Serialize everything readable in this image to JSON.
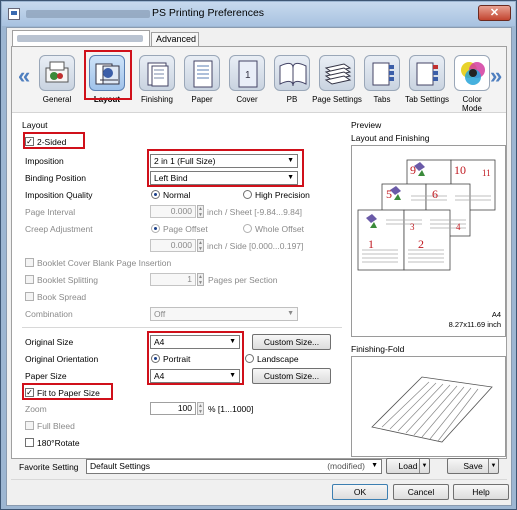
{
  "window": {
    "title": "PS Printing Preferences",
    "close_glyph": "✕"
  },
  "tabs": {
    "advanced": "Advanced"
  },
  "toolbar": {
    "items": [
      {
        "label": "General"
      },
      {
        "label": "Layout"
      },
      {
        "label": "Finishing"
      },
      {
        "label": "Paper"
      },
      {
        "label": "Cover"
      },
      {
        "label": "PB"
      },
      {
        "label": "Page Settings"
      },
      {
        "label": "Tabs"
      },
      {
        "label": "Tab Settings"
      },
      {
        "label": "Color\nMode"
      }
    ],
    "selected": "Layout"
  },
  "layout": {
    "group_title": "Layout",
    "two_sided": {
      "label": "2-Sided",
      "checked": true
    },
    "imposition": {
      "label": "Imposition",
      "value": "2 in 1 (Full Size)"
    },
    "binding_position": {
      "label": "Binding Position",
      "value": "Left Bind"
    },
    "imposition_quality": {
      "label": "Imposition Quality",
      "options": [
        "Normal",
        "High Precision"
      ],
      "selected": "Normal"
    },
    "page_interval": {
      "label": "Page Interval",
      "value": "0.000",
      "unit": "inch / Sheet [-9.84...9.84]"
    },
    "creep_adjustment": {
      "label": "Creep Adjustment",
      "options": [
        "Page Offset",
        "Whole Offset"
      ],
      "value": "0.000",
      "unit": "inch / Side [0.000...0.197]"
    },
    "booklet_cover_blank": {
      "label": "Booklet Cover Blank Page Insertion"
    },
    "booklet_splitting": {
      "label": "Booklet Splitting",
      "value": "1",
      "unit": "Pages per Section"
    },
    "book_spread": {
      "label": "Book Spread"
    },
    "combination": {
      "label": "Combination",
      "value": "Off"
    },
    "original_size": {
      "label": "Original Size",
      "value": "A4",
      "button": "Custom Size..."
    },
    "original_orientation": {
      "label": "Original Orientation",
      "options": [
        "Portrait",
        "Landscape"
      ],
      "selected": "Portrait"
    },
    "paper_size": {
      "label": "Paper Size",
      "value": "A4",
      "button": "Custom Size..."
    },
    "fit_to_paper": {
      "label": "Fit to Paper Size",
      "checked": true
    },
    "zoom": {
      "label": "Zoom",
      "value": "100",
      "unit": "% [1...1000]"
    },
    "full_bleed": {
      "label": "Full Bleed"
    },
    "rotate_180": {
      "label": "180°Rotate"
    }
  },
  "preview": {
    "title": "Preview",
    "subtitle": "Layout and Finishing",
    "page_numbers": [
      "1",
      "2",
      "3",
      "4",
      "5",
      "6",
      "9",
      "10",
      "11"
    ],
    "paper_size": "A4",
    "paper_dims": "8.27x11.69 inch",
    "finishing_fold": "Finishing-Fold"
  },
  "footer": {
    "favorite_label": "Favorite Setting",
    "favorite_value": "Default Settings",
    "modified": "(modified)",
    "load": "Load",
    "save": "Save",
    "ok": "OK",
    "cancel": "Cancel",
    "help": "Help"
  },
  "colors": {
    "highlight": "#d0101a",
    "page_number": "#c0181f",
    "accent": "#4f7fbf"
  }
}
